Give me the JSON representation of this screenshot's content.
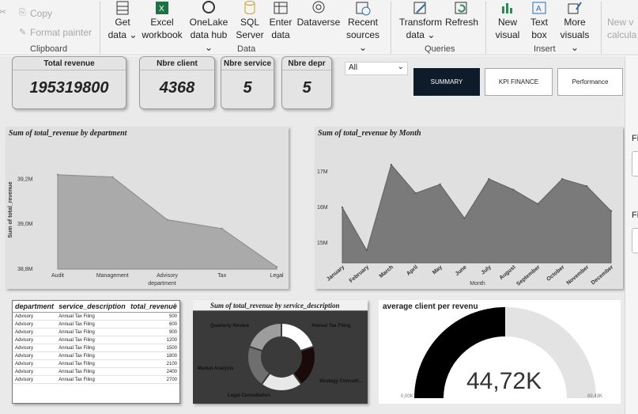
{
  "ribbon": {
    "clipboard": {
      "copy": "Copy",
      "format_painter": "Format painter",
      "label": "Clipboard"
    },
    "data": {
      "label": "Data",
      "items": [
        {
          "line1": "Get",
          "line2": "data ⌄"
        },
        {
          "line1": "Excel",
          "line2": "workbook"
        },
        {
          "line1": "OneLake",
          "line2": "data hub ⌄"
        },
        {
          "line1": "SQL",
          "line2": "Server"
        },
        {
          "line1": "Enter",
          "line2": "data"
        },
        {
          "line1": "Dataverse",
          "line2": ""
        },
        {
          "line1": "Recent",
          "line2": "sources ⌄"
        }
      ]
    },
    "queries": {
      "label": "Queries",
      "items": [
        {
          "line1": "Transform",
          "line2": "data ⌄"
        },
        {
          "line1": "Refresh",
          "line2": ""
        }
      ]
    },
    "insert": {
      "label": "Insert",
      "items": [
        {
          "line1": "New",
          "line2": "visual"
        },
        {
          "line1": "Text",
          "line2": "box"
        },
        {
          "line1": "More",
          "line2": "visuals ⌄"
        }
      ]
    },
    "calc": {
      "line1": "New v",
      "line2": "calcula"
    }
  },
  "kpis": [
    {
      "title": "Total revenue",
      "value": "195319800"
    },
    {
      "title": "Nbre  client",
      "value": "4368"
    },
    {
      "title": "Nbre service",
      "value": "5"
    },
    {
      "title": "Nbre depr",
      "value": "5"
    }
  ],
  "slicer": {
    "value": "All"
  },
  "nav": {
    "summary": "SUMMARY",
    "kpi_finance": "KPI FINANCE",
    "performance": "Performance"
  },
  "dept_chart_title": "Sum of total_revenue by department",
  "month_chart_title": "Sum of total_revenue by Month",
  "donut_title": "Sum of total_revenue by service_description",
  "gauge_title": "average client per revenu",
  "gauge": {
    "value_label": "44,72K",
    "min_label": "0,00K",
    "max_label": "89,43K",
    "fraction": 0.5
  },
  "table": {
    "headers": [
      "department",
      "service_description",
      "total_revenue"
    ],
    "rows": [
      [
        "Advisory",
        "Annual Tax Filing",
        "500"
      ],
      [
        "Advisory",
        "Annual Tax Filing",
        "600"
      ],
      [
        "Advisory",
        "Annual Tax Filing",
        "900"
      ],
      [
        "Advisory",
        "Annual Tax Filing",
        "1200"
      ],
      [
        "Advisory",
        "Annual Tax Filing",
        "1500"
      ],
      [
        "Advisory",
        "Annual Tax Filing",
        "1800"
      ],
      [
        "Advisory",
        "Annual Tax Filing",
        "2100"
      ],
      [
        "Advisory",
        "Annual Tax Filing",
        "2400"
      ],
      [
        "Advisory",
        "Annual Tax Filing",
        "2700"
      ]
    ]
  },
  "right_pane": {
    "label_1": "Fi",
    "label_2": "Fi"
  },
  "colors": {
    "area_fill": "#aaaaaa",
    "month_fill": "#7a7a7a",
    "nav_active": "#0d1b2a",
    "donut_bg": "#3a3a3a",
    "gauge_fill": "#000000",
    "gauge_bg": "#e3e3e3"
  },
  "chart_data": [
    {
      "type": "area",
      "title": "Sum of total_revenue by department",
      "categories": [
        "Audit",
        "Management",
        "Advisory",
        "Tax",
        "Legal"
      ],
      "values": [
        39.22,
        39.21,
        39.02,
        38.98,
        38.81
      ],
      "xlabel": "department",
      "ylabel": "Sum of total_revenue",
      "y_ticks": [
        "39,2M",
        "39,0M",
        "38,8M"
      ],
      "ylim": [
        38.8,
        39.3
      ],
      "unit": "M"
    },
    {
      "type": "area",
      "title": "Sum of total_revenue by Month",
      "categories": [
        "January",
        "February",
        "March",
        "April",
        "May",
        "June",
        "July",
        "August",
        "September",
        "October",
        "November",
        "December"
      ],
      "values": [
        16.0,
        14.8,
        17.2,
        16.4,
        16.65,
        15.7,
        16.8,
        16.5,
        16.1,
        16.8,
        16.6,
        15.9
      ],
      "xlabel": "Month",
      "y_ticks": [
        "17M",
        "16M",
        "15M"
      ],
      "ylim": [
        14.45,
        17.6
      ],
      "unit": "M"
    },
    {
      "type": "pie",
      "title": "Sum of total_revenue by service_description",
      "categories": [
        "Annual Tax Filing",
        "Strategy Consulti...",
        "Legal Consultation",
        "Market Analysis",
        "Quarterly Review"
      ],
      "values": [
        20,
        20,
        20,
        20,
        20
      ]
    }
  ]
}
